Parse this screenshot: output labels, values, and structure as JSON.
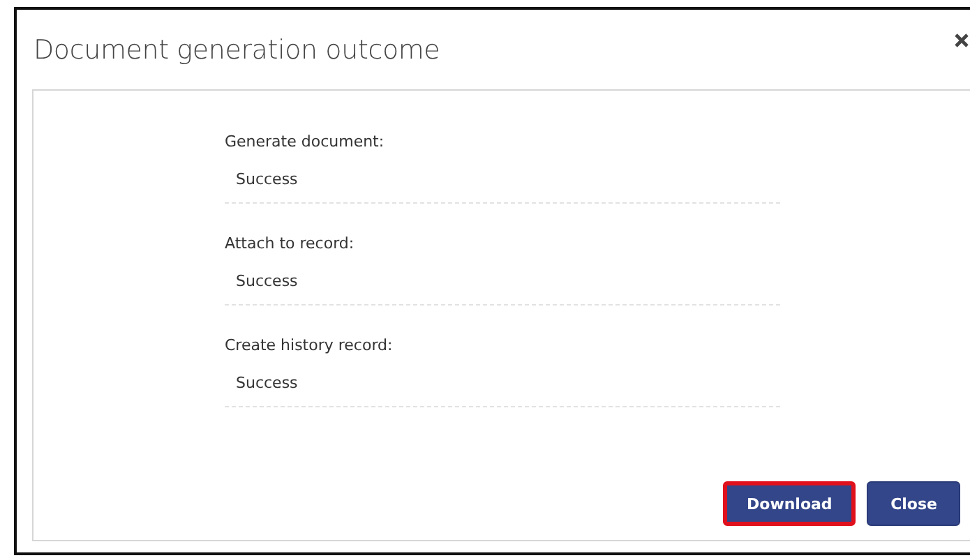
{
  "dialog": {
    "title": "Document generation outcome"
  },
  "fields": [
    {
      "label": "Generate document:",
      "value": "Success"
    },
    {
      "label": "Attach to record:",
      "value": "Success"
    },
    {
      "label": "Create history record:",
      "value": "Success"
    }
  ],
  "buttons": [
    {
      "label": "Download",
      "highlighted": true
    },
    {
      "label": "Close",
      "highlighted": false
    }
  ]
}
